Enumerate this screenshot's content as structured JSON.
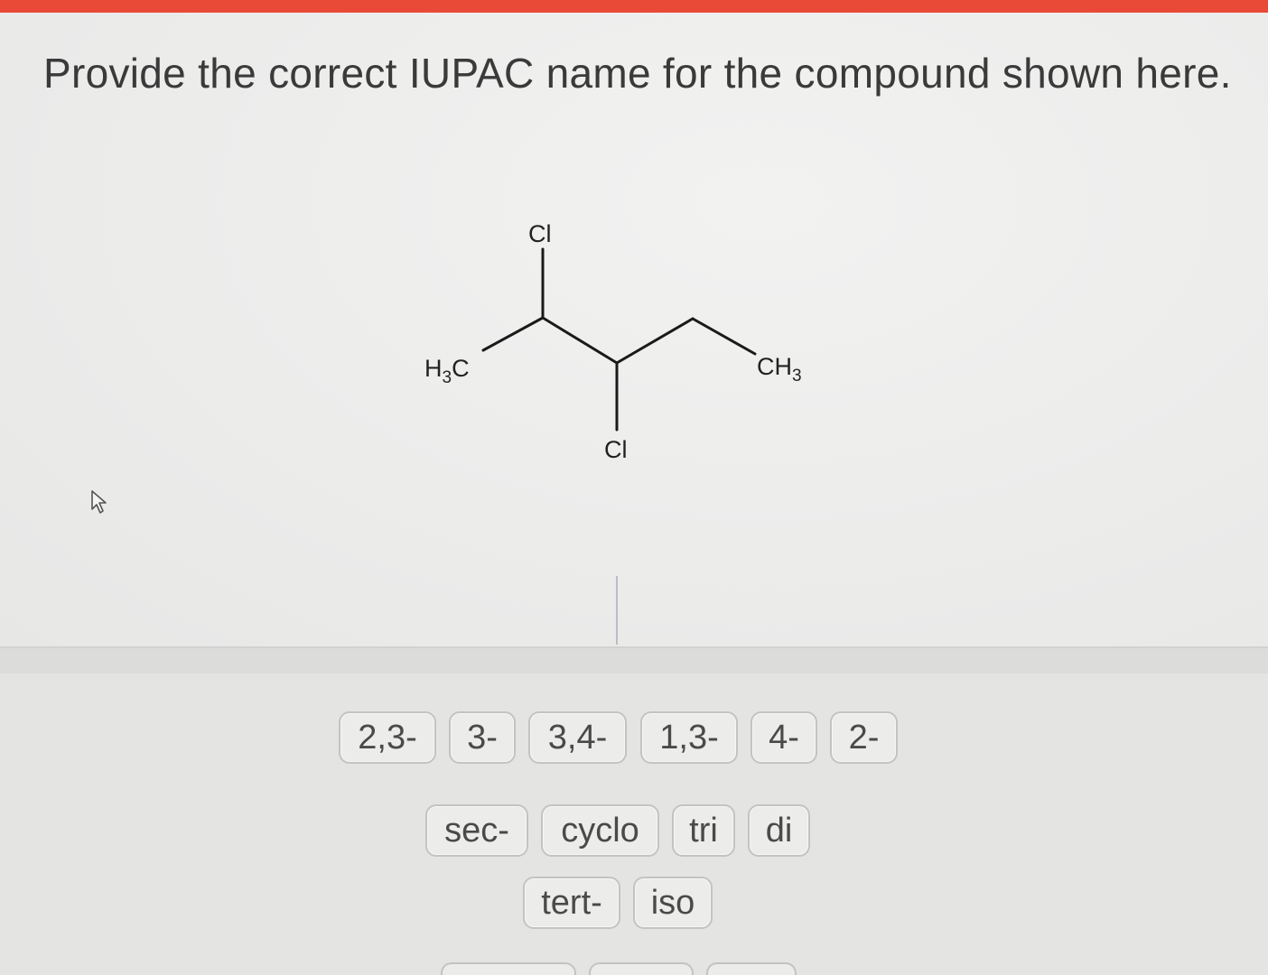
{
  "question": {
    "prompt": "Provide the correct IUPAC name for the compound shown here."
  },
  "molecule": {
    "labels": {
      "cl_top": "Cl",
      "cl_bottom": "Cl",
      "ch3_left_main": "H",
      "ch3_left_sub": "3",
      "ch3_left_tail": "C",
      "ch3_right_main": "CH",
      "ch3_right_sub": "3"
    }
  },
  "tiles": {
    "row1": [
      "2,3-",
      "3-",
      "3,4-",
      "1,3-",
      "4-",
      "2-"
    ],
    "row2": [
      "sec-",
      "cyclo",
      "tri",
      "di"
    ],
    "row3": [
      "tert-",
      "iso"
    ]
  },
  "colors": {
    "accent": "#e94a38",
    "text": "#3a3a3a",
    "bond": "#1a1a1a"
  },
  "icons": {
    "cursor": "pointer-arrow-icon"
  }
}
